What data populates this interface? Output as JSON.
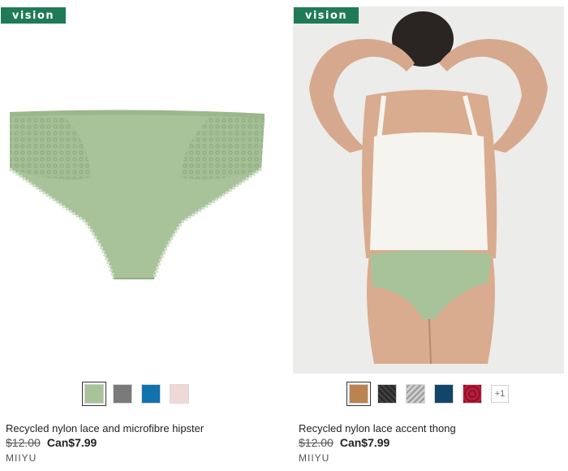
{
  "products": [
    {
      "badge": "vision",
      "title": "Recycled nylon lace and microfibre hipster",
      "old_price": "$12.00",
      "new_price": "Can$7.99",
      "brand": "MIIYU",
      "swatches": [
        {
          "color": "#a8c39a",
          "selected": true
        },
        {
          "color": "#7a7a7a"
        },
        {
          "color": "#1272ae"
        },
        {
          "color": "#efd9d6"
        }
      ]
    },
    {
      "badge": "vision",
      "title": "Recycled nylon lace accent thong",
      "old_price": "$12.00",
      "new_price": "Can$7.99",
      "brand": "MIIYU",
      "swatches": [
        {
          "color": "#b98450",
          "selected": true
        },
        {
          "color": "#2b2b2b",
          "pattern": "lace"
        },
        {
          "color": "#cfcfcf",
          "pattern": "print"
        },
        {
          "color": "#11456a"
        },
        {
          "color": "#b81d3a",
          "pattern": "floral"
        }
      ],
      "more_colors": "+1"
    }
  ],
  "colors": {
    "badge_green": "#1e7b56",
    "garment_green": "#a8c39a",
    "lace_green": "#95b488"
  }
}
